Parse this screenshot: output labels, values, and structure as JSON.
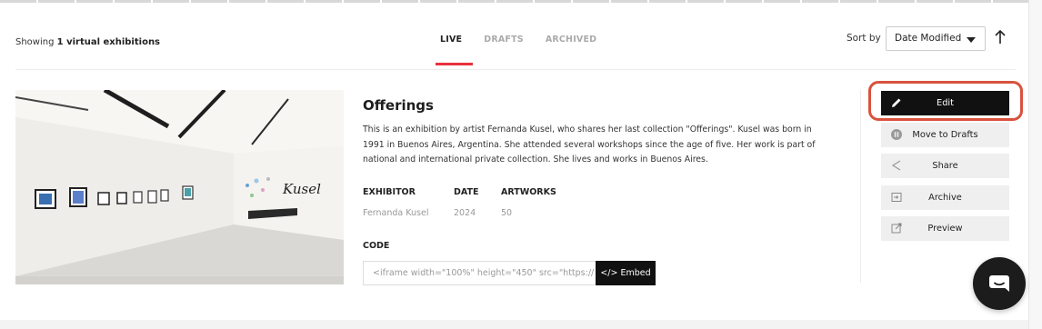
{
  "header": {
    "showing_prefix": "Showing ",
    "showing_count": "1 virtual exhibitions",
    "tabs": [
      {
        "label": "LIVE",
        "active": true
      },
      {
        "label": "DRAFTS",
        "active": false
      },
      {
        "label": "ARCHIVED",
        "active": false
      }
    ],
    "sort_label": "Sort by",
    "sort_value": "Date Modified"
  },
  "exhibition": {
    "title": "Offerings",
    "description": "This is an exhibition by artist Fernanda Kusel, who shares her last collection \"Offerings\". Kusel was born in 1991 in Buenos Aires, Argentina. She attended several workshops since the age of five. Her work is part of national and international private collection. She lives and works in Buenos Aires.",
    "meta_headers": {
      "exhibitor": "EXHIBITOR",
      "date": "DATE",
      "artworks": "ARTWORKS"
    },
    "meta_values": {
      "exhibitor": "Fernanda Kusel",
      "date": "2024",
      "artworks": "50"
    },
    "code_label": "CODE",
    "code_value": "<iframe width=\"100%\" height=\"450\" src=\"https://",
    "embed_label": "</> Embed",
    "wall_signature": "Kusel"
  },
  "actions": {
    "edit": "Edit",
    "move_to_drafts": "Move to Drafts",
    "share": "Share",
    "archive": "Archive",
    "preview": "Preview"
  },
  "colors": {
    "accent": "#e8323c",
    "highlight": "#d9523e",
    "dark": "#111111"
  }
}
